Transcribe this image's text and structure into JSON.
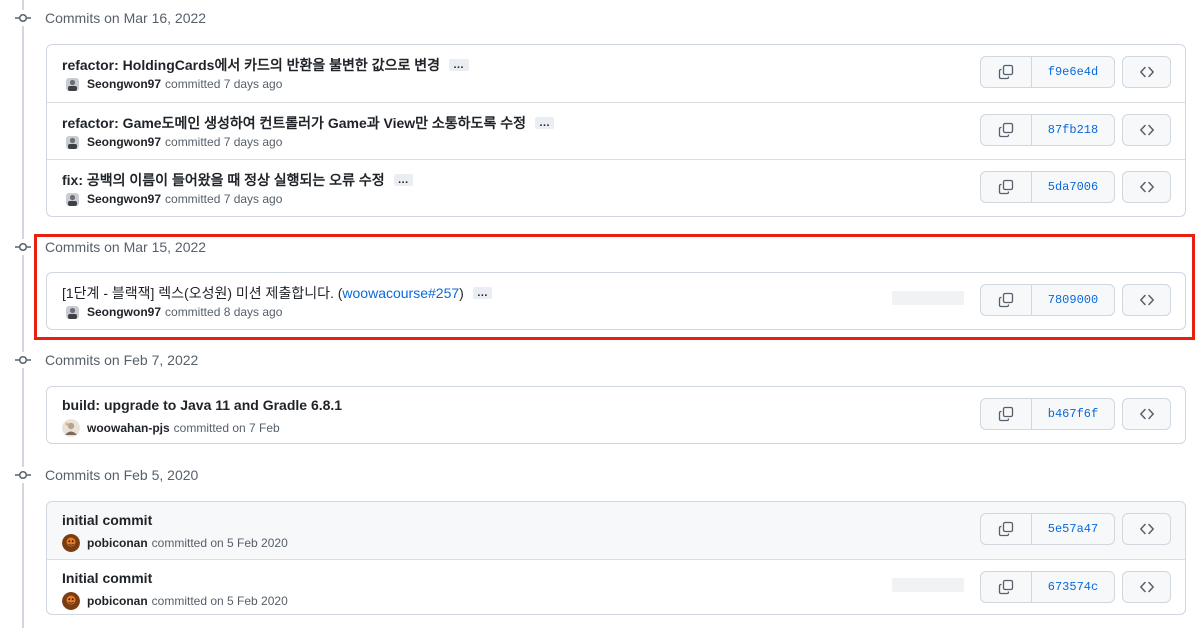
{
  "groups": [
    {
      "title": "Commits on Mar 16, 2022",
      "commits": [
        {
          "message": "refactor: HoldingCards에서 카드의 반환을 불변한 값으로 변경",
          "author": "Seongwon97",
          "time": "committed 7 days ago",
          "sha": "f9e6e4d"
        },
        {
          "message": "refactor: Game도메인 생성하여 컨트롤러가 Game과 View만 소통하도록 수정",
          "author": "Seongwon97",
          "time": "committed 7 days ago",
          "sha": "87fb218"
        },
        {
          "message": "fix: 공백의 이름이 들어왔을 때 정상 실행되는 오류 수정",
          "author": "Seongwon97",
          "time": "committed 7 days ago",
          "sha": "5da7006"
        }
      ]
    },
    {
      "title": "Commits on Mar 15, 2022",
      "commits": [
        {
          "message": "[1단계 - 블랙잭] 렉스(오성원) 미션 제출합니다. (",
          "link": "woowacourse#257",
          "message_end": ")",
          "author": "Seongwon97",
          "time": "committed 8 days ago",
          "sha": "7809000"
        }
      ]
    },
    {
      "title": "Commits on Feb 7, 2022",
      "commits": [
        {
          "message": "build: upgrade to Java 11 and Gradle 6.8.1",
          "author": "woowahan-pjs",
          "time": "committed on 7 Feb",
          "sha": "b467f6f"
        }
      ]
    },
    {
      "title": "Commits on Feb 5, 2020",
      "commits": [
        {
          "message": "initial commit",
          "author": "pobiconan",
          "time": "committed on 5 Feb 2020",
          "sha": "5e57a47"
        },
        {
          "message": "Initial commit",
          "author": "pobiconan",
          "time": "committed on 5 Feb 2020",
          "sha": "673574c"
        }
      ]
    }
  ],
  "ellipsis_label": "…",
  "colors": {
    "link": "#0969da",
    "highlight": "#e8200f",
    "border": "#d0d7de"
  },
  "icons": {
    "commit": "git-commit-icon",
    "copy": "copy-icon",
    "browse": "code-icon"
  }
}
